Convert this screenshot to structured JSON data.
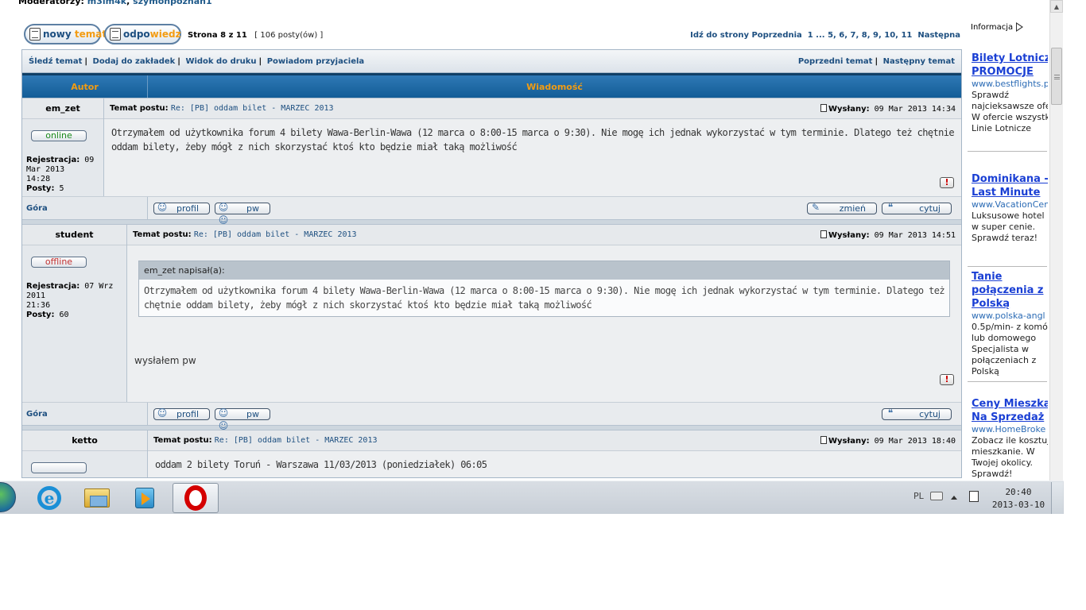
{
  "moderators": {
    "label": "Moderatorzy:",
    "names": [
      "m3lm4k",
      "szymonpoznan1"
    ],
    "sep": ","
  },
  "toolbar": {
    "new_topic_a": "nowy ",
    "new_topic_b": "temat",
    "reply_a": "odpo",
    "reply_b": "wiedz",
    "page_info": "Strona 8 z 11",
    "posts_count": "[ 106 posty(ów) ]",
    "pagination": "Idź do strony Poprzednia  1 ... 5, 6, 7, 8, 9, 10, 11  Następna"
  },
  "navbar": {
    "left": [
      "Śledź temat",
      "Dodaj do zakładek",
      "Widok do druku",
      "Powiadom przyjaciela"
    ],
    "right": [
      "Poprzedni temat",
      "Następny temat"
    ],
    "sep": "|"
  },
  "table_header": {
    "author": "Autor",
    "message": "Wiadomość"
  },
  "labels": {
    "subject": "Temat postu:",
    "sent": "Wysłany:",
    "registration": "Rejestracja:",
    "posts": "Posty:",
    "top": "Góra",
    "profile": "profil",
    "pm": "pw",
    "edit": "zmień",
    "quote": "cytuj",
    "report": "!"
  },
  "posts": [
    {
      "author": "em_zet",
      "status": "online",
      "reg_date": "09 Mar 2013",
      "reg_time": "14:28",
      "post_count": "5",
      "subject": "Re: [PB] oddam bilet - MARZEC 2013",
      "sent": "09 Mar 2013 14:34",
      "body_1": "Otrzymałem od użytkownika forum 4 bilety Wawa-Berlin-Wawa (12 marca o 8:00-15 marca o 9:30). Nie mogę ich jednak wykorzystać w tym terminie. Dlatego też chętnie",
      "body_2": "oddam bilety, żeby mógł z nich skorzystać ktoś kto będzie miał taką możliwość"
    },
    {
      "author": "student",
      "status": "offline",
      "reg_date": "07 Wrz 2011",
      "reg_time": "21:36",
      "post_count": "60",
      "subject": "Re: [PB] oddam bilet - MARZEC 2013",
      "sent": "09 Mar 2013 14:51",
      "quote_author": "em_zet napisał(a):",
      "quote_1": "Otrzymałem od użytkownika forum 4 bilety Wawa-Berlin-Wawa (12 marca o 8:00-15 marca o 9:30). Nie mogę ich jednak wykorzystać w tym terminie. Dlatego też",
      "quote_2": "chętnie oddam bilety, żeby mógł z nich skorzystać ktoś kto będzie miał taką możliwość",
      "body": "wysłałem pw"
    },
    {
      "author": "ketto",
      "subject": "Re: [PB] oddam bilet - MARZEC 2013",
      "sent": "09 Mar 2013 18:40",
      "body_partial": "oddam 2 bilety Toruń - Warszawa 11/03/2013 (poniedziałek) 06:05"
    }
  ],
  "ads": {
    "label": "Informacja",
    "items": [
      {
        "title_1": "Bilety Lotnicze",
        "title_2": "PROMOCJE",
        "url": "www.bestflights.pl",
        "desc": [
          "Sprawdź",
          "najcieksawsze ofe",
          "W ofercie wszystk",
          "Linie Lotnicze"
        ]
      },
      {
        "title_1": "Dominikana -",
        "title_2": "Last Minute",
        "url": "www.VacationCen",
        "desc": [
          "Luksusowe hotel",
          "w super cenie.",
          "Sprawdź teraz!"
        ]
      },
      {
        "title_1": "Tanie",
        "title_2": "połączenia z",
        "title_3": "Polską",
        "url": "www.polska-angl",
        "desc": [
          "0.5p/min- z komó",
          "lub domowego",
          "Specjalista w",
          "połączeniach z",
          "Polską"
        ]
      },
      {
        "title_1": "Ceny Mieszka",
        "title_2": "Na Sprzedaż",
        "url": "www.HomeBroke",
        "desc": [
          "Zobacz ile kosztuj",
          "mieszkanie. W",
          "Twojej okolicy.",
          "Sprawdź!"
        ]
      }
    ]
  },
  "taskbar": {
    "lang": "PL",
    "time": "20:40",
    "date": "2013-03-10"
  }
}
